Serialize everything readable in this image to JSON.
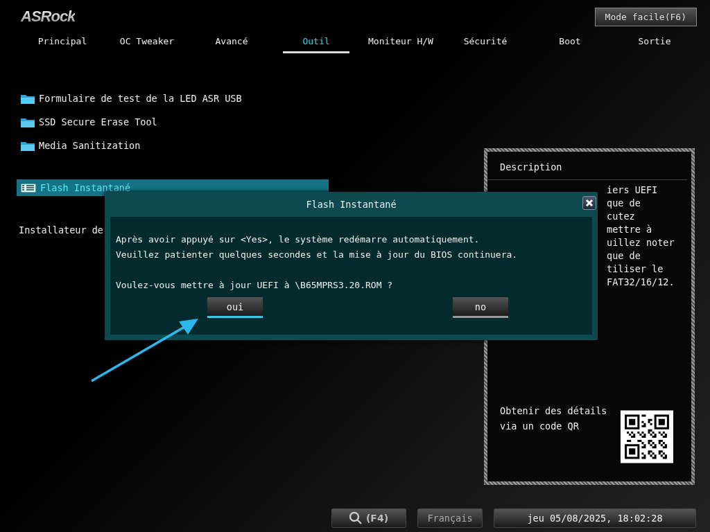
{
  "logo": "ASRock",
  "mode_button": "Mode facile(F6)",
  "tabs": [
    {
      "label": "Principal",
      "selected": false
    },
    {
      "label": "OC Tweaker",
      "selected": false
    },
    {
      "label": "Avancé",
      "selected": false
    },
    {
      "label": "Outil",
      "selected": true
    },
    {
      "label": "Moniteur H/W",
      "selected": false
    },
    {
      "label": "Sécurité",
      "selected": false
    },
    {
      "label": "Boot",
      "selected": false
    },
    {
      "label": "Sortie",
      "selected": false
    }
  ],
  "menu_sections": [
    {
      "items": [
        {
          "kind": "folder",
          "label": "Formulaire de test de la LED ASR USB",
          "selected": false
        },
        {
          "kind": "folder",
          "label": "SSD Secure Erase Tool",
          "selected": false
        },
        {
          "kind": "folder",
          "label": "Media Sanitization",
          "selected": false
        }
      ]
    },
    {
      "items": [
        {
          "kind": "bios",
          "label": "Flash Instantané",
          "selected": true
        }
      ]
    },
    {
      "items": [
        {
          "kind": "plain",
          "label": "Installateur de",
          "selected": false
        }
      ]
    }
  ],
  "description": {
    "title": "Description",
    "lines": [
      "iers UEFI",
      "que de",
      "cutez",
      "mettre à",
      "uillez noter",
      "que de",
      "tiliser le",
      "FAT32/16/12."
    ],
    "qr_caption": "Obtenir des détails via un code QR"
  },
  "dialog": {
    "title": "Flash Instantané",
    "paragraphs": [
      [
        "Après avoir appuyé sur <Yes>, le système redémarre automatiquement.",
        "Veuillez patienter quelques secondes et la mise à jour du BIOS continuera."
      ],
      [
        "Voulez-vous mettre à jour UEFI à \\B65MPRS3.20.ROM ?"
      ]
    ],
    "buttons": [
      {
        "label": "oui",
        "selected": true
      },
      {
        "label": "no",
        "selected": false
      }
    ]
  },
  "footer": {
    "search_key": "(F4)",
    "language": "Français",
    "datetime": "jeu 05/08/2025, 18:02:28"
  }
}
